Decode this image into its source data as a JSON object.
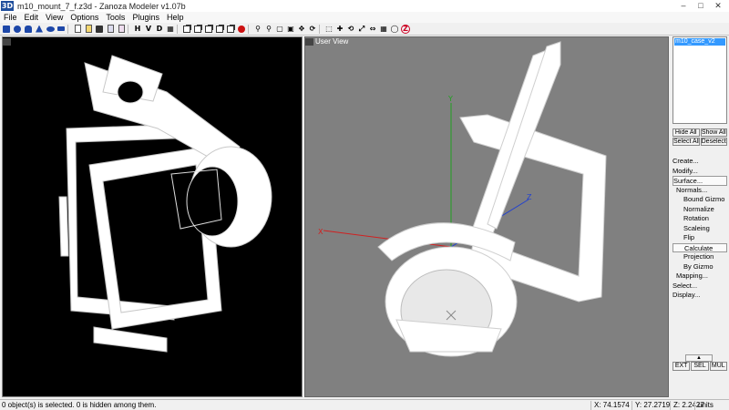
{
  "window": {
    "app_icon": "3D",
    "title": "m10_mount_7_f.z3d - Zanoza Modeler v1.07b",
    "buttons": [
      "minimize-icon",
      "maximize-icon",
      "close-icon"
    ]
  },
  "menu": [
    "File",
    "Edit",
    "View",
    "Options",
    "Tools",
    "Plugins",
    "Help"
  ],
  "toolbar": {
    "h_label": "H",
    "v_label": "V",
    "d_label": "D",
    "z_label": "Z"
  },
  "viewports": {
    "left": {
      "corner": ""
    },
    "right": {
      "corner": "",
      "title": "User View"
    }
  },
  "axes": {
    "x": "X",
    "y": "Y",
    "z": "Z"
  },
  "panel": {
    "objects": [
      "m10_case_v2"
    ],
    "hide_all": "Hide All",
    "show_all": "Show All",
    "select_all": "Select All",
    "deselect": "Deselect",
    "commands": [
      {
        "label": "Create...",
        "level": 0
      },
      {
        "label": "Modify...",
        "level": 0
      },
      {
        "label": "Surface...",
        "level": 0,
        "boxed": true
      },
      {
        "label": "Normals...",
        "level": 1
      },
      {
        "label": "Bound Gizmo",
        "level": 2
      },
      {
        "label": "Normalize",
        "level": 2
      },
      {
        "label": "Rotation",
        "level": 2
      },
      {
        "label": "Scaleing",
        "level": 2
      },
      {
        "label": "Flip",
        "level": 2
      },
      {
        "label": "Calculate",
        "level": 2,
        "boxed": true
      },
      {
        "label": "Projection",
        "level": 2
      },
      {
        "label": "By Gizmo",
        "level": 2
      },
      {
        "label": "Mapping...",
        "level": 1
      },
      {
        "label": "Select...",
        "level": 0
      },
      {
        "label": "Display...",
        "level": 0
      }
    ],
    "modes": [
      "EXT",
      "SEL",
      "MUL"
    ]
  },
  "status": {
    "message": "0 object(s) is selected. 0 is hidden among them.",
    "x": "X: 74.1574",
    "y": "Y: 27.2719",
    "z": "Z: 2.2427",
    "units": "units"
  },
  "colors": {
    "selection": "#3399ff",
    "model": "#ffffff",
    "user_view_bg": "#808080",
    "left_view_bg": "#000000",
    "axis_x": "#d02020",
    "axis_y": "#20a020",
    "axis_z": "#2040d0"
  }
}
